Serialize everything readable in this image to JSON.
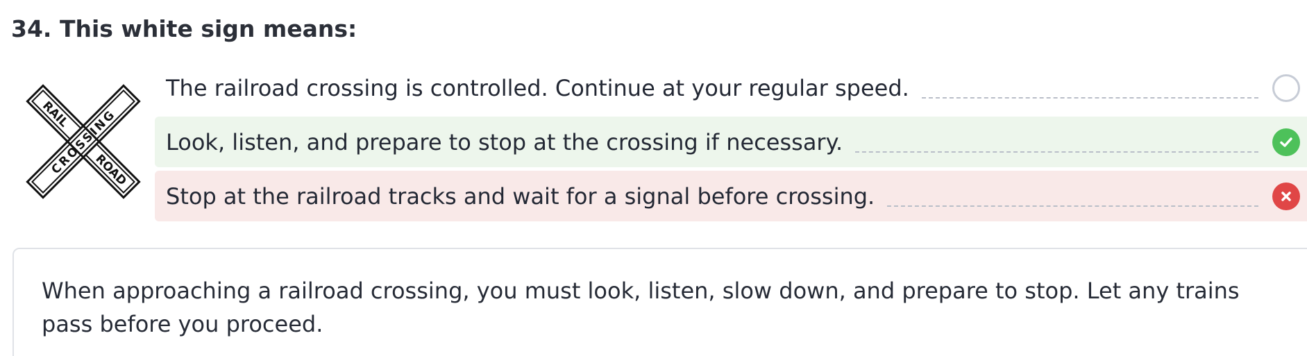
{
  "question": {
    "title": "34. This white sign means:"
  },
  "sign": {
    "icon": "railroad-crossing-sign-icon",
    "word_top_left": "RAIL",
    "word_top_right": "ROAD",
    "word_across": "CROSSING"
  },
  "answers": [
    {
      "text": "The railroad crossing is controlled. Continue at your regular speed.",
      "state": "unselected"
    },
    {
      "text": "Look, listen, and prepare to stop at the crossing if necessary.",
      "state": "correct"
    },
    {
      "text": "Stop at the railroad tracks and wait for a signal before crossing.",
      "state": "incorrect"
    }
  ],
  "explanation": {
    "text": "When approaching a railroad crossing, you must look, listen, slow down, and prepare to stop. Let any trains pass before you proceed."
  },
  "colors": {
    "correct_background": "#edf6ec",
    "incorrect_background": "#f9e9e8",
    "correct_icon": "#4dc15a",
    "incorrect_icon": "#e04646"
  }
}
